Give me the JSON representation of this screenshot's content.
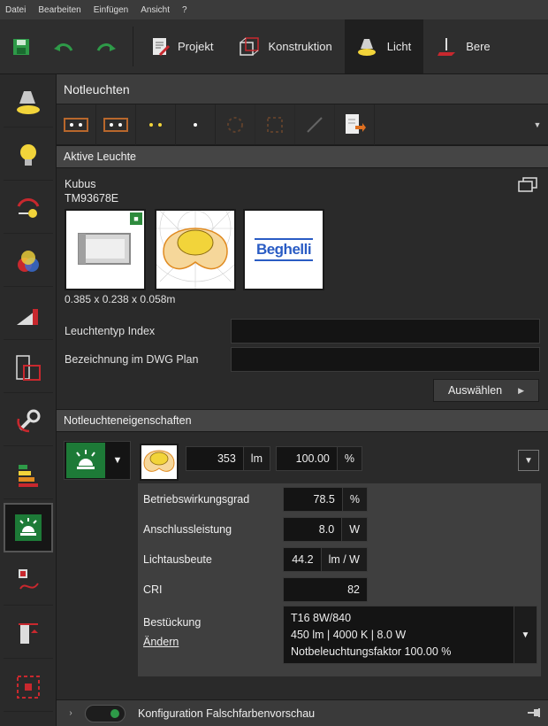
{
  "menu": [
    "Datei",
    "Bearbeiten",
    "Einfügen",
    "Ansicht",
    "?"
  ],
  "main_tabs": [
    {
      "label": "Projekt",
      "icon": "project-icon"
    },
    {
      "label": "Konstruktion",
      "icon": "construction-cube-icon"
    },
    {
      "label": "Licht",
      "icon": "lamp-icon",
      "active": true
    },
    {
      "label": "Bere",
      "icon": "calculation-icon"
    }
  ],
  "panel": {
    "title": "Notleuchten"
  },
  "active_luminaire": {
    "section_title": "Aktive Leuchte",
    "name": "Kubus",
    "article": "TM93678E",
    "brand_logo_text": "Beghelli",
    "dimensions": "0.385 x 0.238 x 0.058m",
    "type_index_label": "Leuchtentyp Index",
    "type_index_value": "",
    "dwg_label": "Bezeichnung im DWG Plan",
    "dwg_value": "",
    "select_button": "Auswählen"
  },
  "properties": {
    "section_title": "Notleuchteneigenschaften",
    "lumen": {
      "value": "353",
      "unit": "lm"
    },
    "percent": {
      "value": "100.00",
      "unit": "%"
    },
    "rows": [
      {
        "label": "Betriebswirkungsgrad",
        "value": "78.5",
        "unit": "%"
      },
      {
        "label": "Anschlussleistung",
        "value": "8.0",
        "unit": "W"
      },
      {
        "label": "Lichtausbeute",
        "value": "44.2",
        "unit": "lm / W"
      },
      {
        "label": "CRI",
        "value": "82",
        "unit": ""
      }
    ],
    "equipment_label": "Bestückung",
    "change_link": "Ändern",
    "equipment_lines": [
      "T16 8W/840",
      "450 lm  |  4000 K  |  8.0 W",
      "Notbeleuchtungsfaktor 100.00 %"
    ]
  },
  "footer": {
    "label": "Konfiguration Falschfarbenvorschau"
  },
  "colors": {
    "accent_green": "#1d7a37",
    "accent_red": "#c8282e",
    "lamp_yellow": "#f2d43a"
  }
}
